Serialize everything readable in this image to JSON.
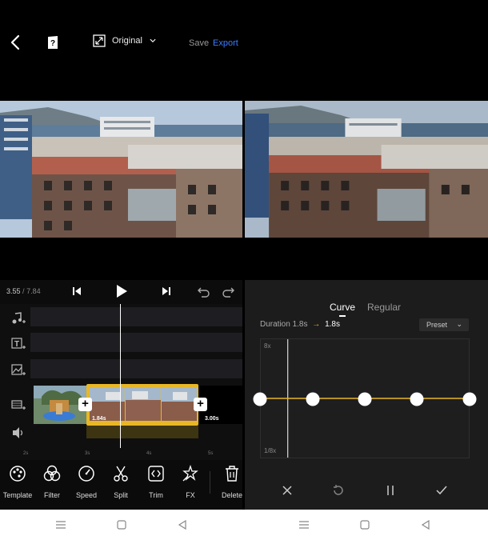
{
  "topbar": {
    "ratio_label": "Original",
    "save_label": "Save",
    "export_label": "Export"
  },
  "player": {
    "current_time": "3.55",
    "total_time": "7.84"
  },
  "timeline": {
    "clip_speed_badge": "1.84s",
    "next_clip_badge": "3.00s",
    "ruler": [
      "2s",
      "3s",
      "4s",
      "5s"
    ]
  },
  "toolbar": {
    "items": [
      {
        "label": "Template",
        "icon": "template-icon"
      },
      {
        "label": "Filter",
        "icon": "filter-icon"
      },
      {
        "label": "Speed",
        "icon": "speed-icon"
      },
      {
        "label": "Split",
        "icon": "scissors-icon"
      },
      {
        "label": "Trim",
        "icon": "trim-icon"
      },
      {
        "label": "FX",
        "icon": "fx-icon"
      },
      {
        "label": "Delete",
        "icon": "trash-icon"
      }
    ]
  },
  "speed_panel": {
    "tabs": [
      "Curve",
      "Regular"
    ],
    "active_tab": "Curve",
    "duration_label": "Duration",
    "duration_from": "1.8s",
    "duration_to": "1.8s",
    "preset_label": "Preset",
    "curve_max_label": "8x",
    "curve_min_label": "1/8x",
    "curve_points": 5
  },
  "colors": {
    "accent_blue": "#3d7bff",
    "clip_yellow": "#e8b726"
  }
}
